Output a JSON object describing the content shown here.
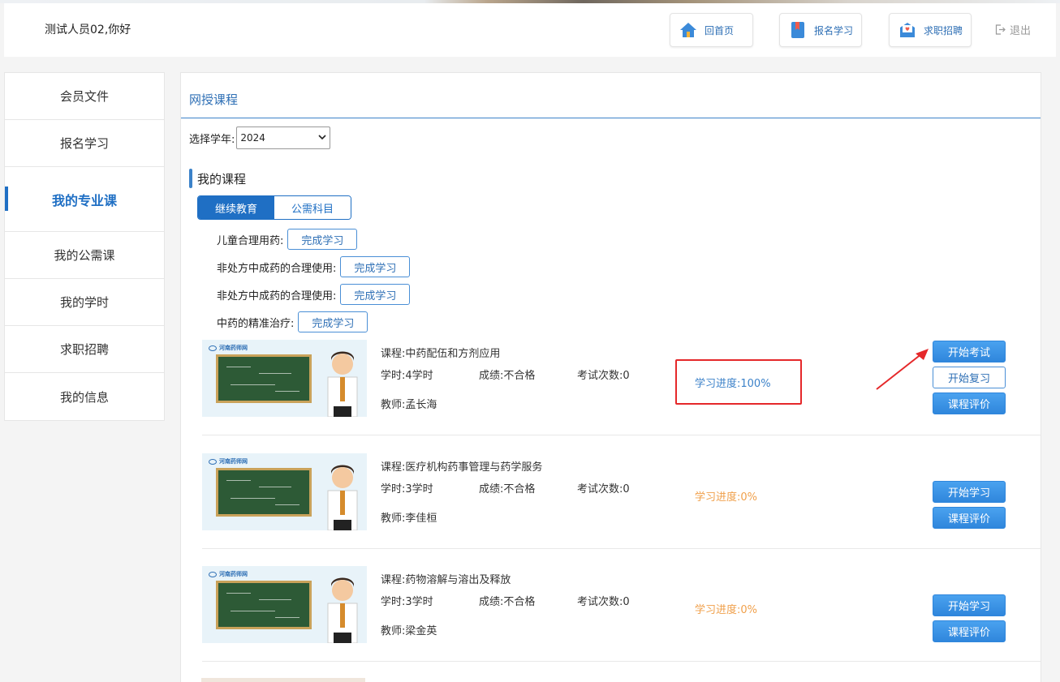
{
  "header": {
    "greeting": "测试人员02,你好",
    "buttons": [
      {
        "label": "回首页",
        "icon": "home-icon"
      },
      {
        "label": "报名学习",
        "icon": "book-icon"
      },
      {
        "label": "求职招聘",
        "icon": "mail-icon"
      }
    ],
    "logout": "退出"
  },
  "sidebar": {
    "items": [
      {
        "label": "会员文件"
      },
      {
        "label": "报名学习"
      },
      {
        "label": "我的专业课",
        "active": true
      },
      {
        "label": "我的公需课"
      },
      {
        "label": "我的学时"
      },
      {
        "label": "求职招聘"
      },
      {
        "label": "我的信息"
      }
    ]
  },
  "main": {
    "title": "网授课程",
    "year_label": "选择学年:",
    "year_value": "2024",
    "section_title": "我的课程",
    "tabs": [
      {
        "label": "继续教育",
        "active": true
      },
      {
        "label": "公需科目"
      }
    ],
    "completed": [
      {
        "name": "儿童合理用药:",
        "button": "完成学习"
      },
      {
        "name": "非处方中成药的合理使用:",
        "button": "完成学习"
      },
      {
        "name": "非处方中成药的合理使用:",
        "button": "完成学习"
      },
      {
        "name": "中药的精准治疗:",
        "button": "完成学习"
      }
    ],
    "courses": [
      {
        "course": "课程:中药配伍和方剂应用",
        "hours": "学时:4学时",
        "score": "成绩:不合格",
        "exams": "考试次数:0",
        "teacher": "教师:孟长海",
        "progress": "学习进度:100%",
        "progress_color": "#3c82c9",
        "buttons": [
          "开始考试",
          "开始复习",
          "课程评价"
        ]
      },
      {
        "course": "课程:医疗机构药事管理与药学服务",
        "hours": "学时:3学时",
        "score": "成绩:不合格",
        "exams": "考试次数:0",
        "teacher": "教师:李佳桓",
        "progress": "学习进度:0%",
        "progress_color": "#f0a04b",
        "buttons": [
          "开始学习",
          "课程评价"
        ]
      },
      {
        "course": "课程:药物溶解与溶出及释放",
        "hours": "学时:3学时",
        "score": "成绩:不合格",
        "exams": "考试次数:0",
        "teacher": "教师:梁金英",
        "progress": "学习进度:0%",
        "progress_color": "#f0a04b",
        "buttons": [
          "开始学习",
          "课程评价"
        ]
      }
    ],
    "thumbnail_logo": "河南药师网"
  }
}
